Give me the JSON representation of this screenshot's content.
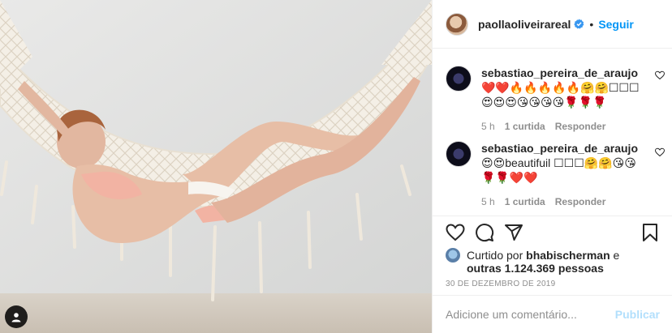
{
  "post": {
    "owner": "paollaoliveirareal",
    "separator": "•",
    "follow_label": "Seguir",
    "likes_prefix": "Curtido por",
    "liked_by": "bhabischerman",
    "likes_others": "outras 1.124.369 pessoas",
    "conjunction": "e",
    "date": "30 DE DEZEMBRO DE 2019"
  },
  "comments": [
    {
      "user": "sebastiao_pereira_de_araujo",
      "text": "❤️❤️🔥🔥🔥🔥🔥🤗🤗☐☐☐😍😍😍😘😘😘😘🌹🌹🌹",
      "time": "5 h",
      "likes": "1 curtida",
      "reply": "Responder"
    },
    {
      "user": "sebastiao_pereira_de_araujo",
      "text": "😍😍beautifuil ☐☐☐🤗🤗😘😘🌹🌹❤️❤️",
      "time": "5 h",
      "likes": "1 curtida",
      "reply": "Responder"
    }
  ],
  "composer": {
    "placeholder": "Adicione um comentário...",
    "publish_label": "Publicar"
  },
  "icons": {
    "verified": "verified-badge-icon",
    "like": "heart-icon",
    "comment": "comment-icon",
    "share": "share-icon",
    "save": "bookmark-icon",
    "tag": "user-tag-icon"
  },
  "colors": {
    "accent": "#0095f6",
    "publish_disabled": "#b2dffc",
    "muted": "#8e8e8e"
  }
}
